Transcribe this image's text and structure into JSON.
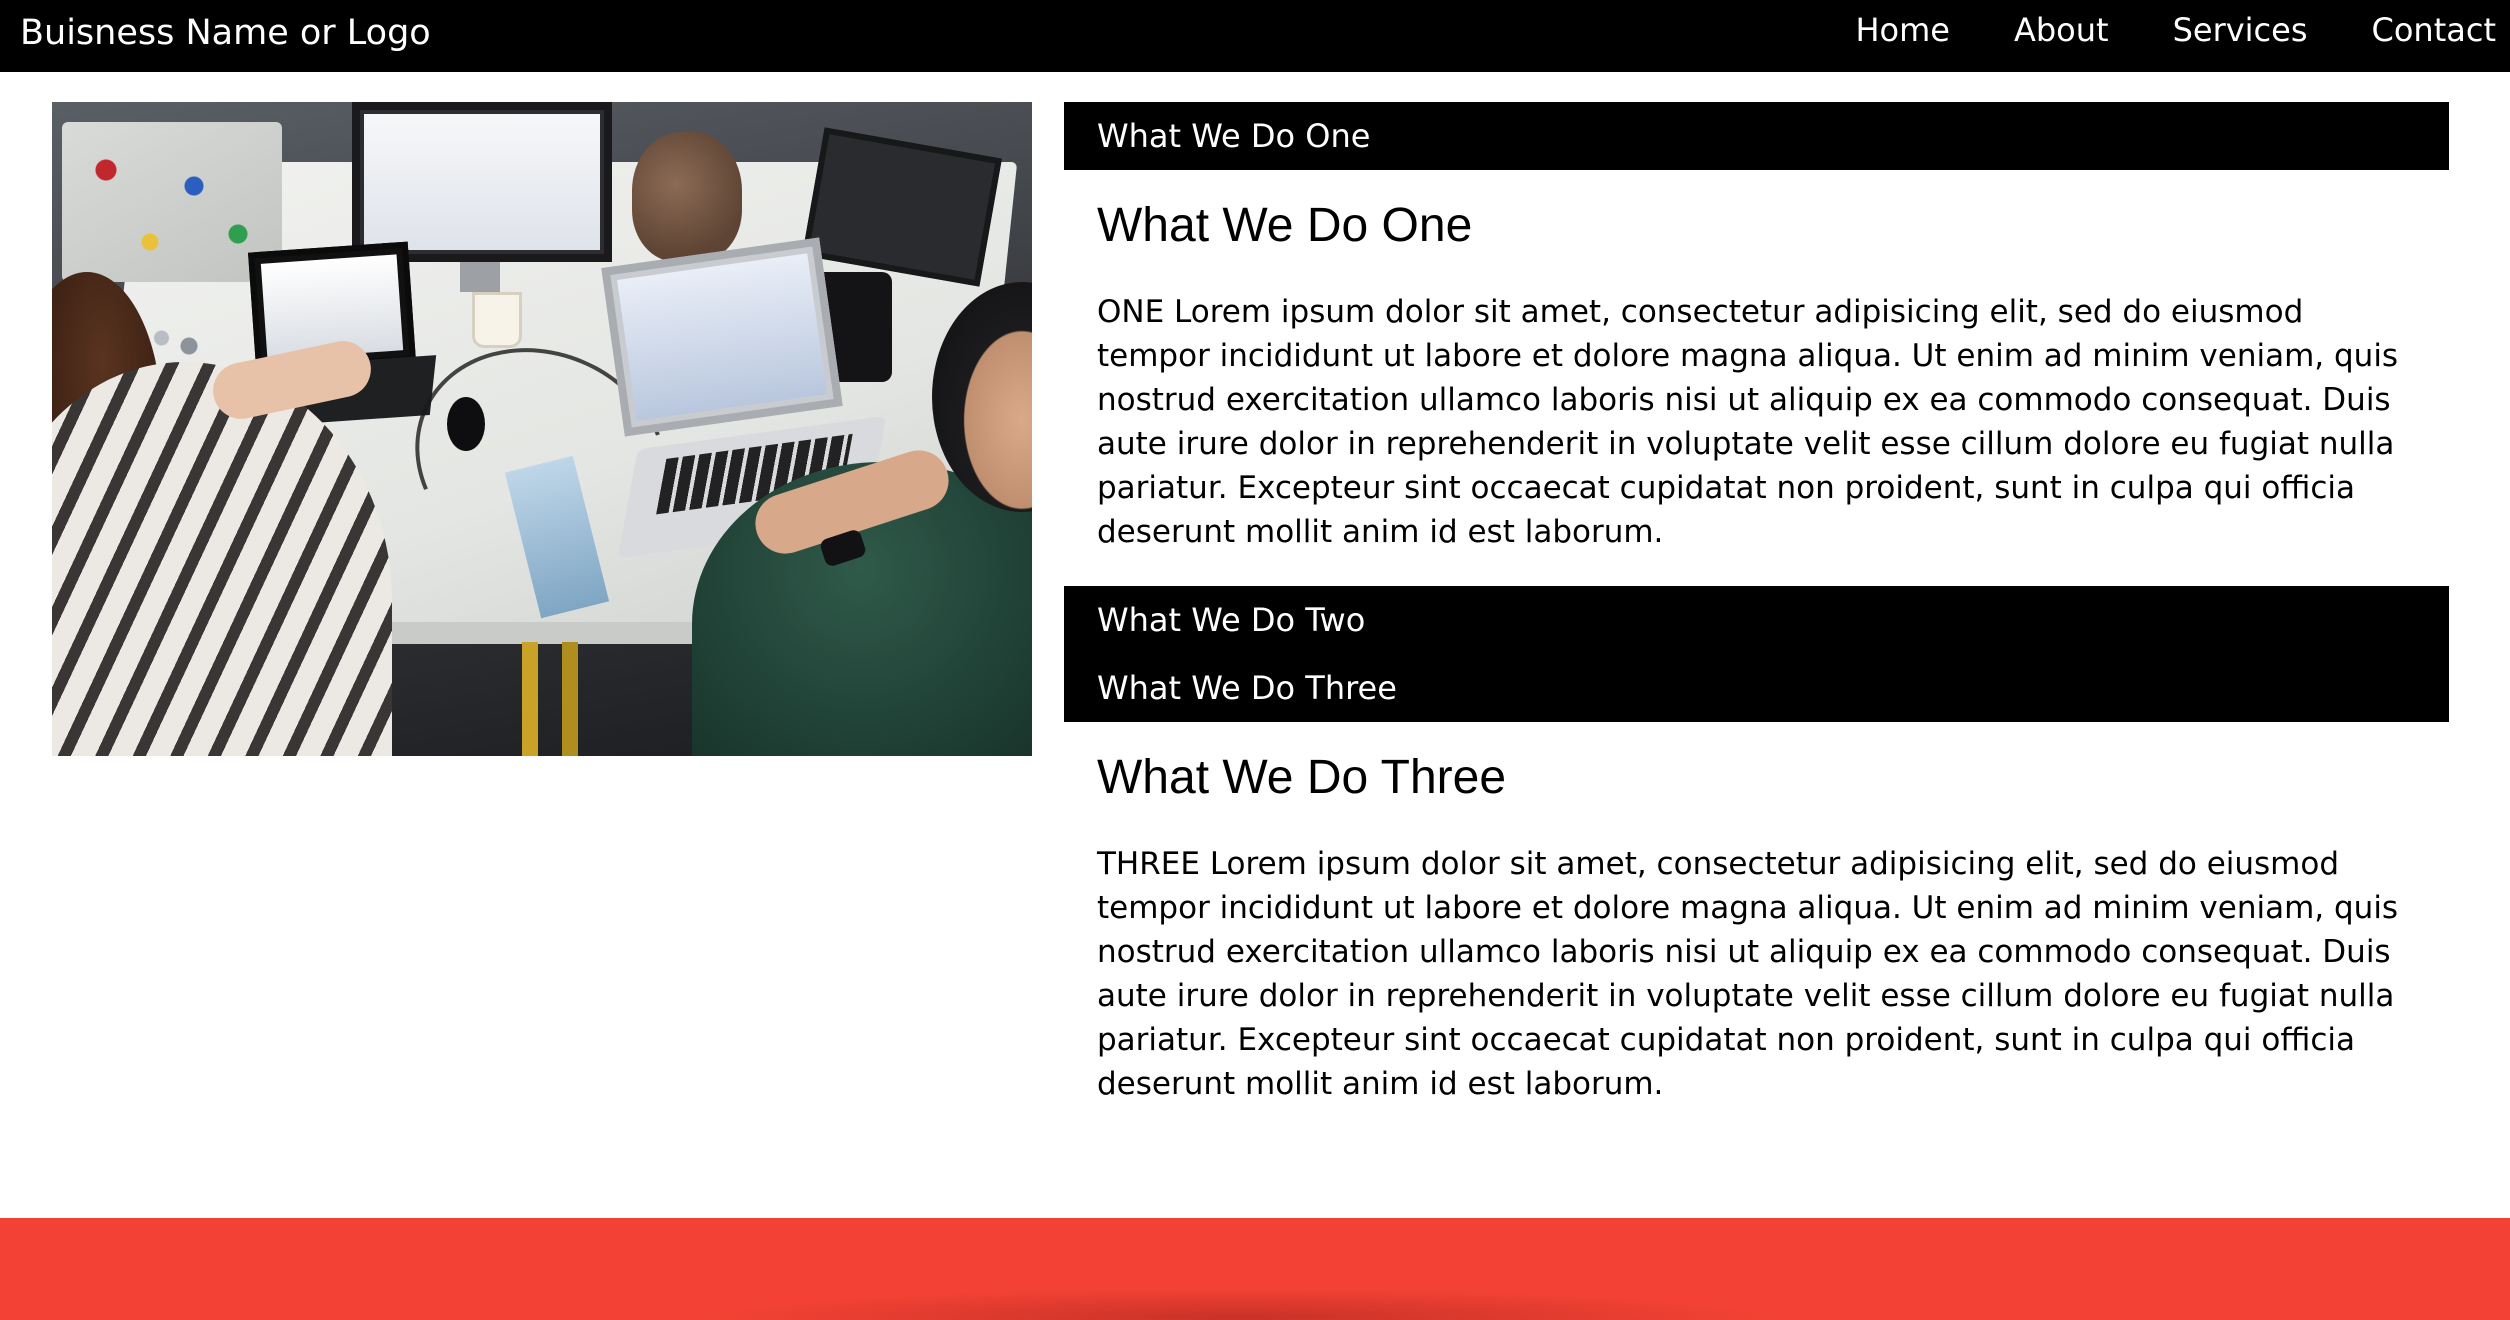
{
  "navbar": {
    "brand": "Buisness Name or Logo",
    "links": [
      "Home",
      "About",
      "Services",
      "Contact"
    ]
  },
  "accordion": {
    "items": [
      {
        "header": "What We Do One",
        "title": "What We Do One",
        "body": "ONE Lorem ipsum dolor sit amet, consectetur adipisicing elit, sed do eiusmod tempor incididunt ut labore et dolore magna aliqua. Ut enim ad minim veniam, quis nostrud exercitation ullamco laboris nisi ut aliquip ex ea commodo consequat. Duis aute irure dolor in reprehenderit in voluptate velit esse cillum dolore eu fugiat nulla pariatur. Excepteur sint occaecat cupidatat non proident, sunt in culpa qui officia deserunt mollit anim id est laborum."
      },
      {
        "header": "What We Do Two"
      },
      {
        "header": "What We Do Three",
        "title": "What We Do Three",
        "body": "THREE Lorem ipsum dolor sit amet, consectetur adipisicing elit, sed do eiusmod tempor incididunt ut labore et dolore magna aliqua. Ut enim ad minim veniam, quis nostrud exercitation ullamco laboris nisi ut aliquip ex ea commodo consequat. Duis aute irure dolor in reprehenderit in voluptate velit esse cillum dolore eu fugiat nulla pariatur. Excepteur sint occaecat cupidatat non proident, sunt in culpa qui officia deserunt mollit anim id est laborum."
      }
    ]
  },
  "colors": {
    "navbar_bg": "#000000",
    "accordion_header_bg": "#000000",
    "footer_bg": "#f34235"
  }
}
